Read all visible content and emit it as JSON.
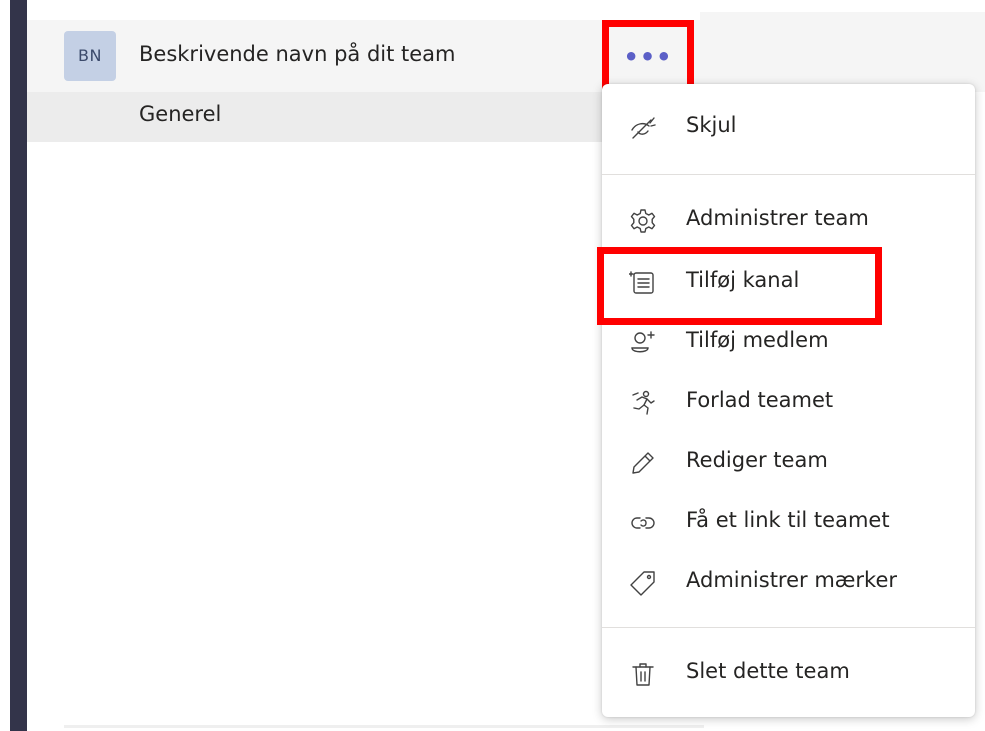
{
  "team": {
    "avatar_initials": "BN",
    "name": "Beskrivende navn på dit team",
    "more_options_label": "•••"
  },
  "channels": [
    {
      "name": "Generel"
    }
  ],
  "menu": {
    "items": [
      {
        "label": "Skjul",
        "icon": "hide-icon"
      },
      {
        "label": "Administrer team",
        "icon": "gear-icon"
      },
      {
        "label": "Tilføj kanal",
        "icon": "add-channel-icon"
      },
      {
        "label": "Tilføj medlem",
        "icon": "add-member-icon"
      },
      {
        "label": "Forlad teamet",
        "icon": "leave-icon"
      },
      {
        "label": "Rediger team",
        "icon": "pencil-icon"
      },
      {
        "label": "Få et link til teamet",
        "icon": "link-icon"
      },
      {
        "label": "Administrer mærker",
        "icon": "tag-icon"
      },
      {
        "label": "Slet dette team",
        "icon": "trash-icon"
      }
    ]
  },
  "colors": {
    "rail": "#33344a",
    "accent": "#5b5fc7",
    "highlight": "#ff0000",
    "avatar_bg": "#c4d0e5"
  }
}
